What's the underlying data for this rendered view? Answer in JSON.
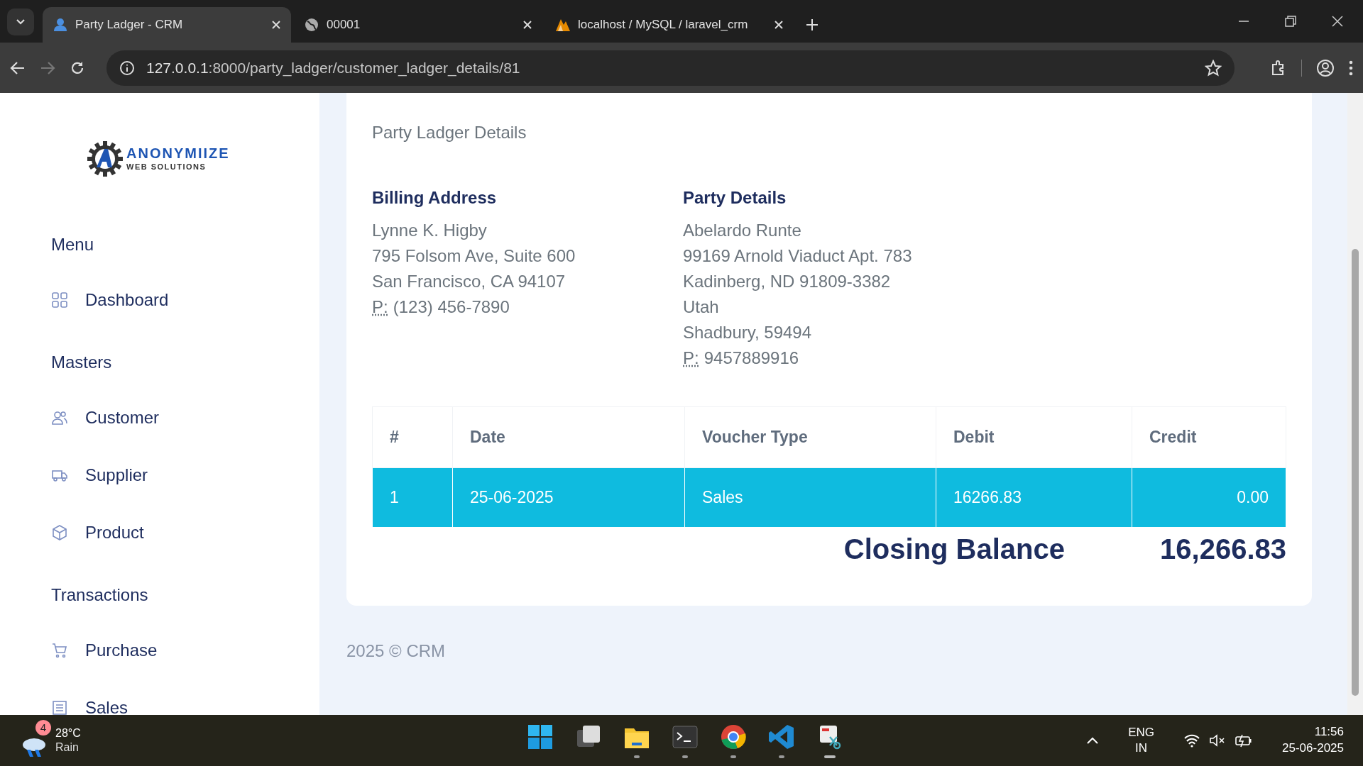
{
  "browser": {
    "tabs": [
      {
        "title": "Party Ladger - CRM",
        "selected": true
      },
      {
        "title": "00001",
        "selected": false
      },
      {
        "title": "localhost / MySQL / laravel_crm",
        "selected": false
      }
    ],
    "url_host": "127.0.0.1",
    "url_path": ":8000/party_ladger/customer_ladger_details/81"
  },
  "sidebar": {
    "logo": {
      "name": "ANONYMIIZE",
      "tagline": "WEB SOLUTIONS"
    },
    "sections": [
      {
        "title": "Menu",
        "items": [
          {
            "label": "Dashboard"
          }
        ]
      },
      {
        "title": "Masters",
        "items": [
          {
            "label": "Customer"
          },
          {
            "label": "Supplier"
          },
          {
            "label": "Product"
          }
        ]
      },
      {
        "title": "Transactions",
        "items": [
          {
            "label": "Purchase"
          },
          {
            "label": "Sales"
          }
        ]
      }
    ]
  },
  "card": {
    "title": "Party Ladger Details",
    "addresses": [
      {
        "heading": "Billing Address",
        "lines": [
          "Lynne K. Higby",
          "795 Folsom Ave, Suite 600",
          "San Francisco, CA 94107"
        ],
        "phone_label": "P:",
        "phone": "(123) 456-7890"
      },
      {
        "heading": "Party Details",
        "lines": [
          "Abelardo Runte",
          "99169 Arnold Viaduct Apt. 783",
          "Kadinberg, ND 91809-3382",
          "Utah",
          "Shadbury, 59494"
        ],
        "phone_label": "P:",
        "phone": "9457889916"
      }
    ],
    "table": {
      "columns": [
        "#",
        "Date",
        "Voucher Type",
        "Debit",
        "Credit"
      ],
      "rows": [
        {
          "cells": [
            "1",
            "25-06-2025",
            "Sales",
            "16266.83",
            "0.00"
          ],
          "highlighted": true
        }
      ]
    },
    "closing_label": "Closing Balance",
    "closing_value": "16,266.83"
  },
  "footer": "2025 © CRM",
  "taskbar": {
    "weather": {
      "badge": "4",
      "temp": "28°C",
      "condition": "Rain"
    },
    "apps": [
      {
        "running": false,
        "active": false
      },
      {
        "running": false,
        "active": false
      },
      {
        "running": true,
        "active": false
      },
      {
        "running": true,
        "active": false
      },
      {
        "running": true,
        "active": false
      },
      {
        "running": true,
        "active": false
      },
      {
        "running": true,
        "active": true
      }
    ],
    "lang": "ENG",
    "region": "IN",
    "time": "11:56",
    "date": "25-06-2025"
  }
}
